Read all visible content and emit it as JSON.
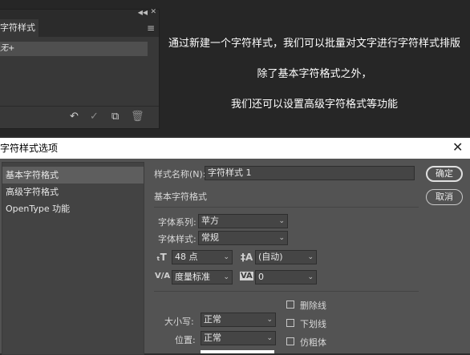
{
  "panel": {
    "tab_label": "字符样式",
    "row_label": "无+",
    "icons": [
      "collapse-icon",
      "panel-menu-icon",
      "clear-override-icon",
      "commit-icon",
      "new-style-icon",
      "delete-icon"
    ]
  },
  "overlay": {
    "line1": "通过新建一个字符样式，我们可以批量对文字进行字符样式排版",
    "line2": "除了基本字符格式之外，",
    "line3": "我们还可以设置高级字符格式等功能"
  },
  "dialog": {
    "title": "字符样式选项",
    "sidebar": [
      {
        "label": "基本字符格式",
        "selected": true
      },
      {
        "label": "高级字符格式",
        "selected": false
      },
      {
        "label": "OpenType 功能",
        "selected": false
      }
    ],
    "style_name_label": "样式名称(N):",
    "style_name_value": "字符样式 1",
    "section_title": "基本字符格式",
    "font_family_label": "字体系列:",
    "font_family_value": "苹方",
    "font_style_label": "字体样式:",
    "font_style_value": "常规",
    "font_size_value": "48 点",
    "leading_value": "(自动)",
    "kerning_value": "度量标准",
    "tracking_value": "0",
    "case_label": "大小写:",
    "case_value": "正常",
    "position_label": "位置:",
    "position_value": "正常",
    "checkboxes": {
      "strikethrough": "删除线",
      "underline": "下划线",
      "faux_bold": "仿粗体"
    },
    "ok_label": "确定",
    "cancel_label": "取消"
  }
}
